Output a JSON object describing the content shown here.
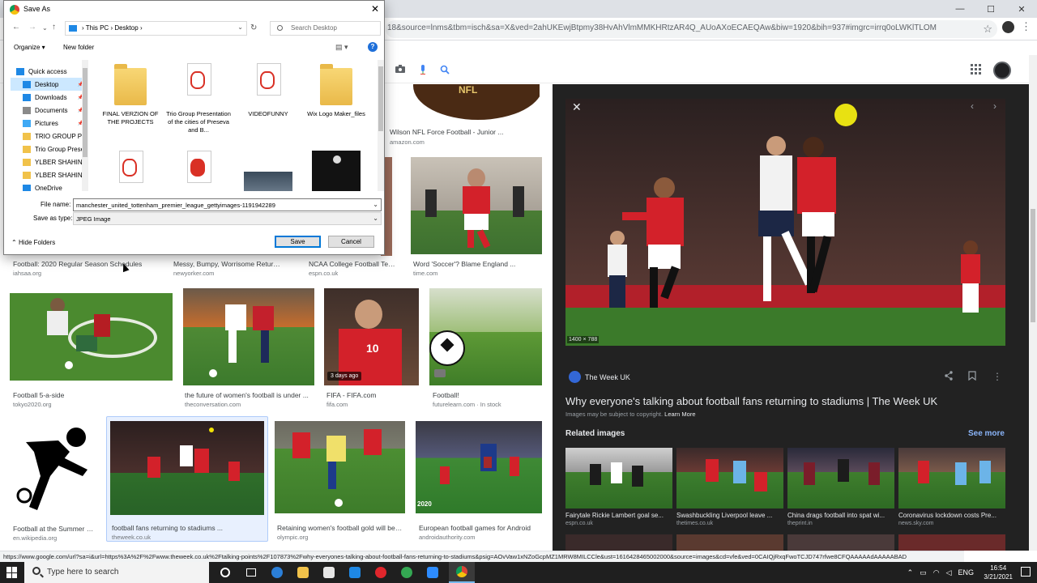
{
  "browser": {
    "url": "18&source=lnms&tbm=isch&sa=X&ved=2ahUKEwjBtpmy38HvAhVlmMMKHRtzAR4Q_AUoAXoECAEQAw&biw=1920&bih=937#imgrc=irrq0oLWKlTLOM",
    "status_url": "https://www.google.com/url?sa=i&url=https%3A%2F%2Fwww.theweek.co.uk%2Ftalking-points%2F107873%2Fwhy-everyones-talking-about-football-fans-returning-to-stadiums&psig=AOvVaw1xNZoGcpMZ1MRW8MILCCle&ust=1616428465002000&source=images&cd=vfe&ved=0CAIQjRxqFwoTCJD747rfwe8CFQAAAAAdAAAAABAD"
  },
  "dialog": {
    "title": "Save As",
    "breadcrumb": [
      "This PC",
      "Desktop"
    ],
    "search_placeholder": "Search Desktop",
    "organize": "Organize ▾",
    "new_folder": "New folder",
    "help": "?",
    "nav_items": [
      {
        "label": "Quick access",
        "icon": "star-icon",
        "color": "#1e88e5"
      },
      {
        "label": "Desktop",
        "icon": "desktop-folder-icon",
        "color": "#1e88e5",
        "selected": true
      },
      {
        "label": "Downloads",
        "icon": "download-icon",
        "color": "#1e88e5"
      },
      {
        "label": "Documents",
        "icon": "documents-icon",
        "color": "#8a8a8a"
      },
      {
        "label": "Pictures",
        "icon": "pictures-icon",
        "color": "#3fa9f5"
      },
      {
        "label": "TRIO GROUP PRI",
        "icon": "folder-icon",
        "color": "#f1c24a"
      },
      {
        "label": "Trio Group Prese",
        "icon": "folder-icon",
        "color": "#f1c24a"
      },
      {
        "label": "YLBER SHAHINI",
        "icon": "folder-icon",
        "color": "#f1c24a"
      },
      {
        "label": "YLBER SHAHINI",
        "icon": "folder-icon",
        "color": "#f1c24a"
      },
      {
        "label": "OneDrive",
        "icon": "cloud-icon",
        "color": "#1e88e5"
      }
    ],
    "files": [
      {
        "name": "FINAL VERZION OF THE PROJECTS",
        "icon": "folder-icon"
      },
      {
        "name": "Trio Group Presentation of the cities of Preseva and B...",
        "icon": "pdf-icon"
      },
      {
        "name": "VIDEOFUNNY",
        "icon": "pdf-icon"
      },
      {
        "name": "Wix Logo Maker_files",
        "icon": "folder-icon"
      }
    ],
    "file_name_label": "File name:",
    "file_name": "manchester_united_tottenham_premier_league_gettyimages-1191942289",
    "save_as_type_label": "Save as type:",
    "save_as_type": "JPEG Image",
    "hide_folders": "Hide Folders",
    "save": "Save",
    "cancel": "Cancel"
  },
  "grid": {
    "row1": [
      {
        "caption": "Wilson NFL Force Football - Junior ...",
        "source": "amazon.com"
      }
    ],
    "row2": [
      {
        "caption": "Football: 2020 Regular Season Schedules",
        "source": "iahsaa.org"
      },
      {
        "caption": "Messy, Bumpy, Worrisome Return ...",
        "source": "newyorker.com"
      },
      {
        "caption": "NCAA College Football Tea...",
        "source": "espn.co.uk"
      },
      {
        "caption": "Word 'Soccer'? Blame England ...",
        "source": "time.com"
      }
    ],
    "row3": [
      {
        "caption": "Football 5-a-side",
        "source": "tokyo2020.org"
      },
      {
        "caption": "the future of women's football is under ...",
        "source": "theconversation.com"
      },
      {
        "caption": "FIFA - FIFA.com",
        "source": "fifa.com",
        "badge": "3 days ago"
      },
      {
        "caption": "Football!",
        "source": "futurelearn.com · In stock"
      }
    ],
    "row4": [
      {
        "caption": "Football at the Summer Ol...",
        "source": "en.wikipedia.org"
      },
      {
        "caption": "football fans returning to stadiums ...",
        "source": "theweek.co.uk"
      },
      {
        "caption": "Retaining women's football gold will be ...",
        "source": "olympic.org"
      },
      {
        "caption": "European football games for Android",
        "source": "androidauthority.com"
      }
    ]
  },
  "preview": {
    "dimensions": "1400 × 788",
    "site": "The Week UK",
    "title": "Why everyone's talking about football fans returning to stadiums | The Week UK",
    "copyright": "Images may be subject to copyright.",
    "learn_more": "Learn More",
    "related_heading": "Related images",
    "see_more": "See more",
    "related": [
      {
        "caption": "Fairytale Rickie Lambert goal se...",
        "source": "espn.co.uk"
      },
      {
        "caption": "Swashbuckling Liverpool leave ...",
        "source": "thetimes.co.uk"
      },
      {
        "caption": "China drags football into spat wi...",
        "source": "theprint.in"
      },
      {
        "caption": "Coronavirus lockdown costs Pre...",
        "source": "news.sky.com"
      }
    ]
  },
  "taskbar": {
    "search_placeholder": "Type here to search",
    "language": "ENG",
    "time": "16:54",
    "date": "3/21/2021"
  }
}
